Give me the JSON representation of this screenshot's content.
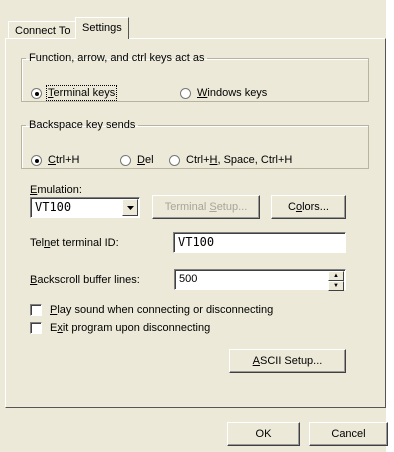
{
  "tabs": [
    {
      "label": "Connect To",
      "active": false
    },
    {
      "label": "Settings",
      "active": true
    }
  ],
  "function_keys": {
    "legend": "Function, arrow, and ctrl keys act as",
    "options": [
      {
        "label": "Terminal keys",
        "selected": true
      },
      {
        "label": "Windows keys",
        "selected": false
      }
    ]
  },
  "backspace": {
    "legend": "Backspace key sends",
    "options": [
      {
        "label": "Ctrl+H",
        "selected": true
      },
      {
        "label": "Del",
        "selected": false
      },
      {
        "label": "Ctrl+H, Space, Ctrl+H",
        "selected": false
      }
    ]
  },
  "emulation": {
    "label": "Emulation:",
    "value": "VT100",
    "terminal_setup_label": "Terminal Setup...",
    "colors_label": "Colors..."
  },
  "telnet": {
    "label": "Telnet terminal ID:",
    "value": "VT100"
  },
  "backscroll": {
    "label": "Backscroll buffer lines:",
    "value": "500"
  },
  "checkboxes": [
    {
      "label": "Play sound when connecting or disconnecting",
      "checked": false
    },
    {
      "label": "Exit program upon disconnecting",
      "checked": false
    }
  ],
  "ascii_setup_label": "ASCII Setup...",
  "ok_label": "OK",
  "cancel_label": "Cancel"
}
